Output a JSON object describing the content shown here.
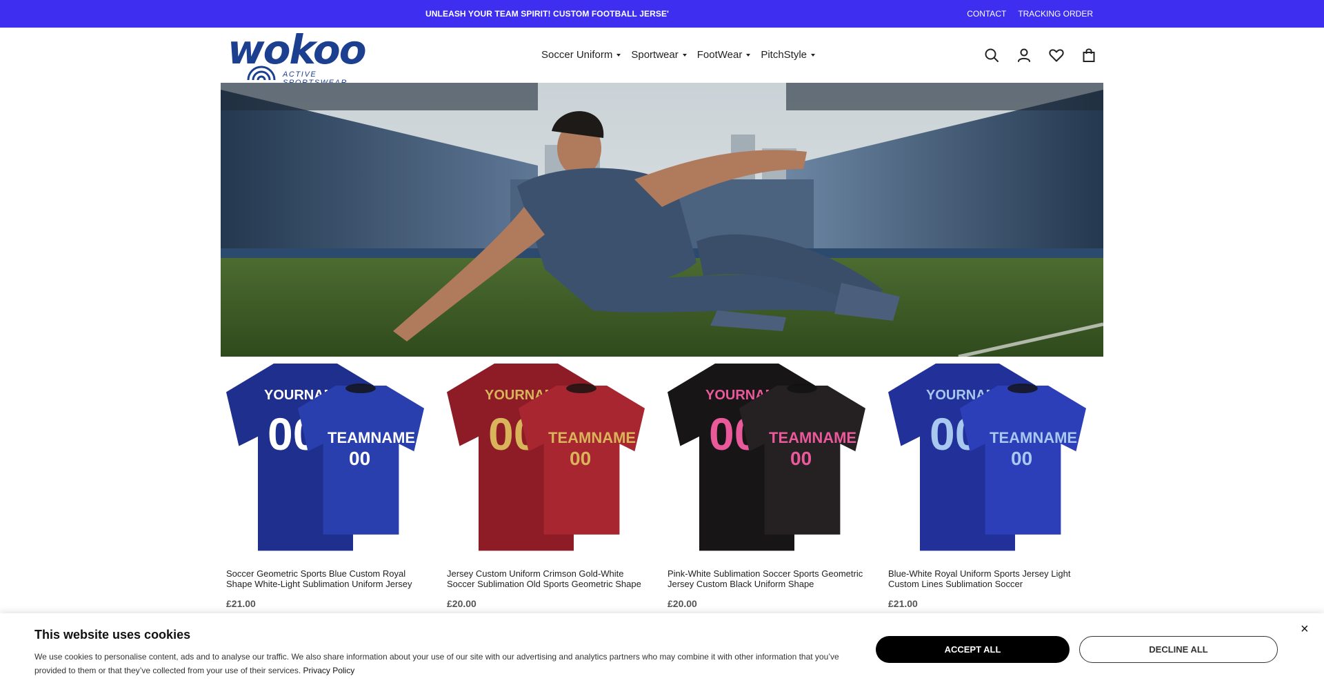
{
  "announcement": {
    "text": "UNLEASH YOUR TEAM SPIRIT! CUSTOM FOOTBALL JERSE'",
    "links": [
      "CONTACT",
      "TRACKING ORDER"
    ]
  },
  "header": {
    "logo_word": "wokoo",
    "logo_tagline": "ACTIVE SPORTSWEAR",
    "nav": [
      {
        "label": "Soccer Uniform"
      },
      {
        "label": "Sportwear"
      },
      {
        "label": "FootWear"
      },
      {
        "label": "PitchStyle"
      }
    ],
    "icons": [
      "search-icon",
      "account-icon",
      "wishlist-icon",
      "cart-icon"
    ]
  },
  "products": [
    {
      "title": "Soccer Geometric Sports Blue Custom Royal Shape White-Light Sublimation Uniform Jersey",
      "price": "£21.00",
      "back_text": "YOURNAME",
      "front_text": "TEAMNAME",
      "number": "00",
      "colors": {
        "shirt": "#2a3fae",
        "shirt_dark": "#1e2f8e",
        "text": "#ffffff"
      }
    },
    {
      "title": "Jersey Custom Uniform Crimson Gold-White Soccer Sublimation Old Sports Geometric Shape",
      "price": "£20.00",
      "back_text": "YOURNAME",
      "front_text": "TEAMNAME",
      "number": "00",
      "colors": {
        "shirt": "#a82630",
        "shirt_dark": "#8e1c26",
        "text": "#d9b45a"
      }
    },
    {
      "title": "Pink-White Sublimation Soccer Sports Geometric Jersey Custom Black Uniform Shape",
      "price": "£20.00",
      "back_text": "YOURNAME",
      "front_text": "TEAMNAME",
      "number": "00",
      "colors": {
        "shirt": "#252122",
        "shirt_dark": "#181516",
        "text": "#ea5a9b"
      }
    },
    {
      "title": "Blue-White Royal Uniform Sports Jersey Light Custom Lines Sublimation Soccer",
      "price": "£21.00",
      "back_text": "YOURNAME",
      "front_text": "TEAMNAME",
      "number": "00",
      "colors": {
        "shirt": "#2d3fb8",
        "shirt_dark": "#22309a",
        "text": "#a8c8f0"
      }
    }
  ],
  "cookie": {
    "title": "This website uses cookies",
    "text": "We use cookies to personalise content, ads and to analyse our traffic. We also share information about your use of our site with our advertising and analytics partners who may combine it with other information that you’ve provided to them or that they’ve collected from your use of their services.",
    "link": "Privacy Policy",
    "accept": "ACCEPT ALL",
    "decline": "DECLINE ALL",
    "close": "×"
  }
}
